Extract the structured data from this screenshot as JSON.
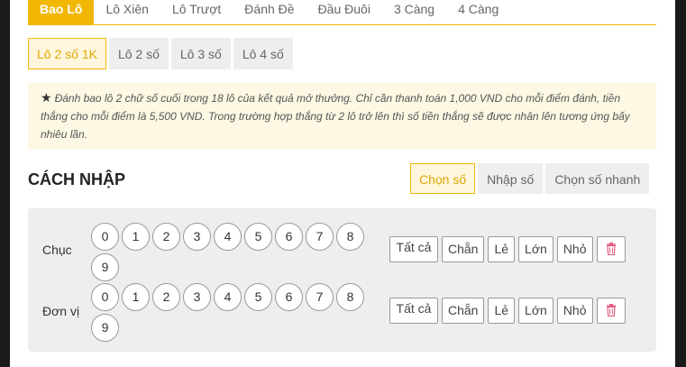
{
  "top_tabs": [
    {
      "label": "Bao Lô"
    },
    {
      "label": "Lô Xiên"
    },
    {
      "label": "Lô Trượt"
    },
    {
      "label": "Đánh Đề"
    },
    {
      "label": "Đầu Đuôi"
    },
    {
      "label": "3 Càng"
    },
    {
      "label": "4 Càng"
    }
  ],
  "sub_tabs": [
    {
      "label": "Lô 2 số 1K"
    },
    {
      "label": "Lô 2 số"
    },
    {
      "label": "Lô 3 số"
    },
    {
      "label": "Lô 4 số"
    }
  ],
  "notice": {
    "icon": "star-icon",
    "text": "Đánh bao lô 2 chữ số cuối trong 18 lô của kết quả mở thưởng. Chỉ cần thanh toán 1,000 VND cho mỗi điểm đánh, tiền thắng cho mỗi điểm là 5,500 VND. Trong trường hợp thắng từ 2 lô trở lên thì số tiền thắng sẽ được nhân lên tương ứng bấy nhiêu lần."
  },
  "section": {
    "title": "CÁCH NHẬP"
  },
  "mode_tabs": [
    {
      "label": "Chọn số"
    },
    {
      "label": "Nhập số"
    },
    {
      "label": "Chọn số nhanh"
    }
  ],
  "rows": [
    {
      "label": "Chục"
    },
    {
      "label": "Đơn vị"
    }
  ],
  "digits": [
    "0",
    "1",
    "2",
    "3",
    "4",
    "5",
    "6",
    "7",
    "8",
    "9"
  ],
  "quick_buttons": {
    "all": "Tất cả",
    "even": "Chẵn",
    "odd": "Lẻ",
    "big": "Lớn",
    "small": "Nhỏ",
    "clear_icon": "trash-icon"
  },
  "colors": {
    "accent": "#f2b705",
    "notice_bg": "#fcf8e3",
    "panel_bg": "#eeeeee",
    "trash": "#e05a7a"
  }
}
